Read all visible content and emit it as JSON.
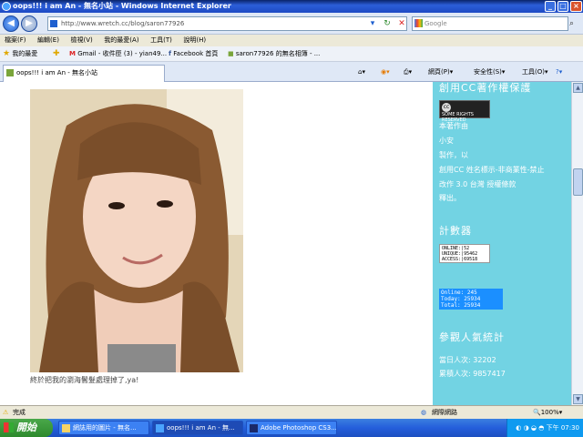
{
  "window": {
    "title": "oops!!! i am An - 無名小站 - Windows Internet Explorer"
  },
  "address": {
    "url": "http://www.wretch.cc/blog/saron77926",
    "search_placeholder": "Google"
  },
  "menu": [
    "檔案(F)",
    "編輯(E)",
    "檢視(V)",
    "我的最愛(A)",
    "工具(T)",
    "說明(H)"
  ],
  "favorites": {
    "label": "我的最愛",
    "links": [
      "Gmail - 收件匣 (3) - yian49...",
      "Facebook 首頁",
      "saron77926 的無名相簿 - ..."
    ]
  },
  "tab": {
    "label": "oops!!! i am An - 無名小站"
  },
  "commands": [
    "網頁(P)",
    "安全性(S)",
    "工具(O)"
  ],
  "post": {
    "caption": "終於把我的瀏海鬢髮處理掉了,ya!"
  },
  "sidebar": {
    "cc_heading": "創用CC著作權保護",
    "cc_badge": "SOME RIGHTS RESERVED",
    "cc_lines": [
      "本著作由",
      "小安",
      "製作，以",
      "創用CC 姓名標示-非商業性-禁止",
      "改作 3.0 台灣 授權條款",
      "釋出。"
    ],
    "counter_heading": "計數器",
    "counter1": [
      "ONLINE:|52",
      "UNIQUE:|95462",
      "ACCESS:|69518"
    ],
    "counter2": [
      "Online: 245",
      "Today: 25934",
      "Total: 25934"
    ],
    "stats_heading": "參觀人氣統計",
    "today_label": "當日人次: 32202",
    "total_label": "累積人次: 9857417"
  },
  "status": {
    "text": "完成",
    "zone": "網際網路",
    "zoom": "100%"
  },
  "taskbar": {
    "start": "開始",
    "tasks": [
      "網誌用的圖片 - 無名...",
      "oops!!! i am An - 無...",
      "Adobe Photoshop CS3..."
    ],
    "clock": "下午 07:30"
  }
}
